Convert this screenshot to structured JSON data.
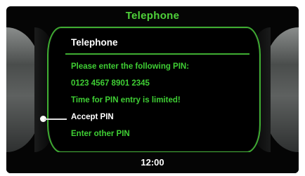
{
  "header": {
    "title": "Telephone"
  },
  "dialog": {
    "title": "Telephone",
    "messages": [
      "Please enter the following PIN:",
      "0123 4567 8901 2345",
      "Time for PIN entry is limited!"
    ],
    "options": [
      {
        "label": "Accept PIN",
        "selected": true
      },
      {
        "label": "Enter other PIN",
        "selected": false
      }
    ]
  },
  "status": {
    "time": "12:00"
  },
  "colors": {
    "accent_green": "#3fcf34",
    "frame_green": "#3fae32",
    "header_green": "#4fd23a",
    "selected_text": "#ffffff",
    "background": "#050505"
  }
}
